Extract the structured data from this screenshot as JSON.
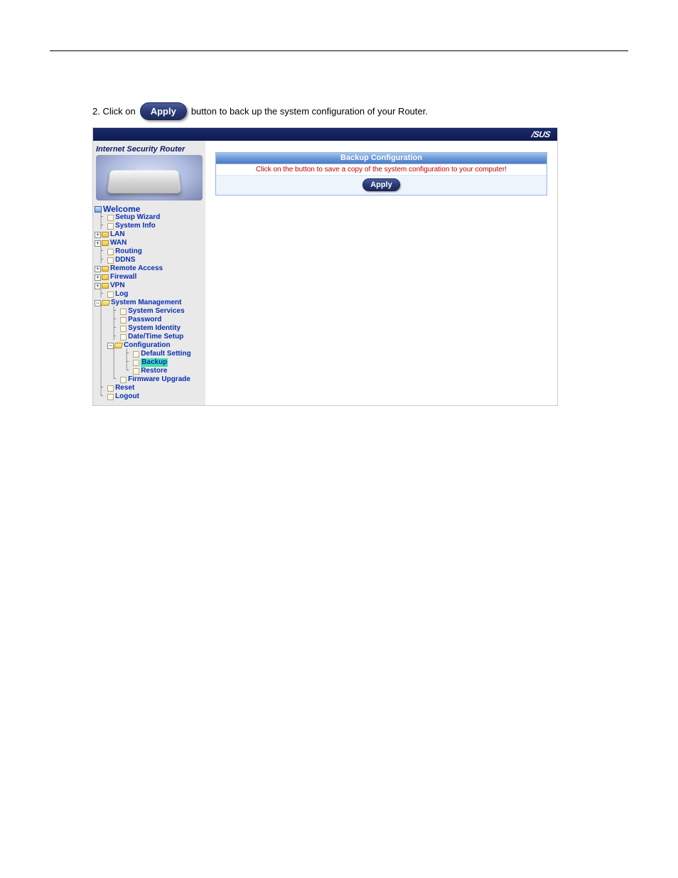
{
  "header": {
    "left": "",
    "comma": ""
  },
  "doc": {
    "section_title": "",
    "intro_1": "",
    "intro_2": "",
    "backup_heading": "",
    "step1_text": "",
    "step2_prefix": "2.  Click on",
    "apply_btn_label": "Apply",
    "step2_suffix": "button to back up the system configuration of your Router."
  },
  "router": {
    "brand": "/SUS",
    "product_title": "Internet Security Router",
    "panel_title": "Backup Configuration",
    "panel_instruction": "Click on the button to save a copy of the system configuration to your computer!",
    "panel_apply": "Apply",
    "tree": {
      "root": "Welcome",
      "setup_wizard": "Setup Wizard",
      "system_info": "System Info",
      "lan": "LAN",
      "wan": "WAN",
      "routing": "Routing",
      "ddns": "DDNS",
      "remote_access": "Remote Access",
      "firewall": "Firewall",
      "vpn": "VPN",
      "log": "Log",
      "sys_mgmt": "System Management",
      "sys_services": "System Services",
      "password": "Password",
      "sys_identity": "System Identity",
      "datetime": "Date/Time Setup",
      "configuration": "Configuration",
      "default_setting": "Default Setting",
      "backup": "Backup",
      "restore": "Restore",
      "firmware": "Firmware Upgrade",
      "reset": "Reset",
      "logout": "Logout"
    }
  },
  "figure_caption": ""
}
